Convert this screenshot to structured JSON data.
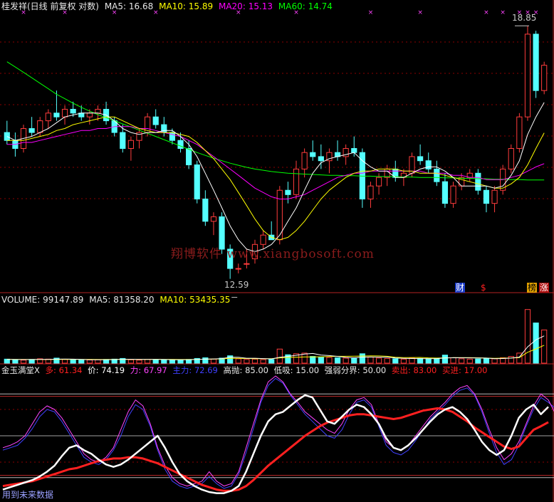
{
  "price_header": {
    "title": "桂发祥(日线 前复权 对数)",
    "ma5_label": "MA5:",
    "ma5_value": "16.68",
    "ma10_label": "MA10:",
    "ma10_value": "15.89",
    "ma20_label": "MA20:",
    "ma20_value": "15.13",
    "ma60_label": "MA60:",
    "ma60_value": "14.74"
  },
  "volume_header": {
    "vol_label": "VOLUME:",
    "vol_value": "99147.89",
    "ma5_label": "MA5:",
    "ma5_value": "81358.20",
    "ma10_label": "MA10:",
    "ma10_value": "53435.35"
  },
  "indicator_header": {
    "title": "金玉满堂X",
    "duo_label": "多:",
    "duo_value": "61.34",
    "jia_label": "价:",
    "jia_value": "74.19",
    "li_label": "力:",
    "li_value": "67.97",
    "zhuli_label": "主力:",
    "zhuli_value": "72.69",
    "gaopao_label": "高抛:",
    "gaopao_value": "85.00",
    "dixi_label": "低吸:",
    "dixi_value": "15.00",
    "qiangruo_label": "强弱分界:",
    "qiangruo_value": "50.00",
    "maichu_label": "卖出:",
    "maichu_value": "83.00",
    "maijin_label": "买进:",
    "maijin_value": "17.00"
  },
  "annotations": {
    "high_price": "18.85",
    "low_price": "12.59",
    "cai_tag": "财",
    "dollar_tag": "$",
    "bang_tag": "榜",
    "zhang_tag": "涨",
    "future_data_note": "用到未来数据",
    "watermark": "翔博软件 www.xiangbosoft.com"
  },
  "colors": {
    "up": "#ff3c3c",
    "down": "#54ffff",
    "ma5": "#ffffff",
    "ma10": "#ffff00",
    "ma20": "#ff00ff",
    "ma60": "#00ff00",
    "grid": "#8b0000",
    "divider": "#b22222",
    "duo": "#ff2020",
    "jia": "#ffffff",
    "li": "#ff44ff",
    "zhuli": "#4040ff"
  },
  "chart_data": [
    {
      "type": "candlestick",
      "scale": "log",
      "series_names": [
        "MA5",
        "MA10",
        "MA20",
        "MA60"
      ],
      "last_ma": {
        "MA5": 16.68,
        "MA10": 15.89,
        "MA20": 15.13,
        "MA60": 14.74
      },
      "ylim": [
        12.4,
        19.2
      ],
      "high": 18.85,
      "low": 12.59,
      "ohlc": [
        [
          15.9,
          16.2,
          15.6,
          15.7
        ],
        [
          15.7,
          15.9,
          15.3,
          15.5
        ],
        [
          15.5,
          16.1,
          15.4,
          16.0
        ],
        [
          16.0,
          16.3,
          15.8,
          15.9
        ],
        [
          15.9,
          16.3,
          15.8,
          16.2
        ],
        [
          16.2,
          16.5,
          16.0,
          16.4
        ],
        [
          16.4,
          17.0,
          16.2,
          16.3
        ],
        [
          16.3,
          16.6,
          16.1,
          16.5
        ],
        [
          16.5,
          16.7,
          16.3,
          16.4
        ],
        [
          16.4,
          16.6,
          16.2,
          16.3
        ],
        [
          16.3,
          16.5,
          16.1,
          16.4
        ],
        [
          16.4,
          16.6,
          16.2,
          16.5
        ],
        [
          16.5,
          16.7,
          16.1,
          16.2
        ],
        [
          16.2,
          16.3,
          15.8,
          15.9
        ],
        [
          15.9,
          16.1,
          15.4,
          15.5
        ],
        [
          15.5,
          15.8,
          15.2,
          15.7
        ],
        [
          15.7,
          16.0,
          15.5,
          15.9
        ],
        [
          15.9,
          16.4,
          15.8,
          16.3
        ],
        [
          16.3,
          16.5,
          16.0,
          16.1
        ],
        [
          16.1,
          16.3,
          15.8,
          15.9
        ],
        [
          15.9,
          16.0,
          15.6,
          15.7
        ],
        [
          15.7,
          15.9,
          15.4,
          15.5
        ],
        [
          15.5,
          15.7,
          15.0,
          15.1
        ],
        [
          15.1,
          15.2,
          14.2,
          14.3
        ],
        [
          14.3,
          14.5,
          13.7,
          13.8
        ],
        [
          13.8,
          14.0,
          13.5,
          13.9
        ],
        [
          13.9,
          14.0,
          13.1,
          13.2
        ],
        [
          13.2,
          13.3,
          12.59,
          12.8
        ],
        [
          12.8,
          12.9,
          12.7,
          12.8
        ],
        [
          12.9,
          13.2,
          12.8,
          12.9
        ],
        [
          13.0,
          13.4,
          12.9,
          13.3
        ],
        [
          13.3,
          13.6,
          13.2,
          13.5
        ],
        [
          13.5,
          13.8,
          13.4,
          13.4
        ],
        [
          13.4,
          14.6,
          13.3,
          14.5
        ],
        [
          14.5,
          14.7,
          14.2,
          14.4
        ],
        [
          14.4,
          15.2,
          14.3,
          15.0
        ],
        [
          15.0,
          15.5,
          14.8,
          15.4
        ],
        [
          15.4,
          15.7,
          15.2,
          15.3
        ],
        [
          15.3,
          15.6,
          15.0,
          15.2
        ],
        [
          15.2,
          15.5,
          14.9,
          15.4
        ],
        [
          15.4,
          15.7,
          15.2,
          15.3
        ],
        [
          15.3,
          15.6,
          15.1,
          15.5
        ],
        [
          15.5,
          15.8,
          15.3,
          15.4
        ],
        [
          15.4,
          15.5,
          14.1,
          14.3
        ],
        [
          14.3,
          14.7,
          14.1,
          14.6
        ],
        [
          14.6,
          14.9,
          14.4,
          14.8
        ],
        [
          14.8,
          15.1,
          14.6,
          15.0
        ],
        [
          15.0,
          15.2,
          14.7,
          14.8
        ],
        [
          14.8,
          15.0,
          14.6,
          14.9
        ],
        [
          14.9,
          15.4,
          14.8,
          15.3
        ],
        [
          15.3,
          15.6,
          15.1,
          15.2
        ],
        [
          15.2,
          15.4,
          14.9,
          15.0
        ],
        [
          15.0,
          15.2,
          14.6,
          14.7
        ],
        [
          14.7,
          14.9,
          14.1,
          14.2
        ],
        [
          14.2,
          14.7,
          14.1,
          14.6
        ],
        [
          14.6,
          14.9,
          14.5,
          14.8
        ],
        [
          14.8,
          15.0,
          14.7,
          14.9
        ],
        [
          14.9,
          15.0,
          14.4,
          14.5
        ],
        [
          14.5,
          14.6,
          14.0,
          14.2
        ],
        [
          14.2,
          14.6,
          14.0,
          14.5
        ],
        [
          14.5,
          15.1,
          14.4,
          15.0
        ],
        [
          15.0,
          15.6,
          14.9,
          15.5
        ],
        [
          15.5,
          16.4,
          15.4,
          16.3
        ],
        [
          16.3,
          18.85,
          16.2,
          18.6
        ],
        [
          18.6,
          18.7,
          16.8,
          17.0
        ],
        [
          17.0,
          17.8,
          16.9,
          17.7
        ]
      ],
      "ma5": [
        15.8,
        15.7,
        15.75,
        15.8,
        15.9,
        16.0,
        16.15,
        16.3,
        16.35,
        16.4,
        16.4,
        16.4,
        16.35,
        16.2,
        16.0,
        15.9,
        15.85,
        15.9,
        15.9,
        15.95,
        15.95,
        15.8,
        15.6,
        15.3,
        14.9,
        14.5,
        14.1,
        13.7,
        13.4,
        13.2,
        13.15,
        13.2,
        13.3,
        13.5,
        13.8,
        14.1,
        14.5,
        14.9,
        15.15,
        15.25,
        15.3,
        15.35,
        15.4,
        15.2,
        15.05,
        14.95,
        14.95,
        14.8,
        14.8,
        14.9,
        15.0,
        15.05,
        15.05,
        14.95,
        14.8,
        14.6,
        14.6,
        14.6,
        14.6,
        14.55,
        14.6,
        14.85,
        15.2,
        15.85,
        16.3,
        16.68
      ],
      "ma10": [
        15.7,
        15.7,
        15.7,
        15.75,
        15.8,
        15.85,
        15.95,
        16.0,
        16.1,
        16.15,
        16.2,
        16.25,
        16.3,
        16.3,
        16.2,
        16.1,
        16.0,
        15.95,
        15.9,
        15.9,
        15.9,
        15.85,
        15.8,
        15.65,
        15.45,
        15.25,
        15.0,
        14.75,
        14.45,
        14.15,
        13.85,
        13.6,
        13.45,
        13.4,
        13.45,
        13.6,
        13.8,
        14.05,
        14.3,
        14.5,
        14.65,
        14.8,
        14.9,
        14.95,
        14.95,
        15.0,
        15.0,
        15.0,
        14.95,
        14.95,
        14.9,
        14.9,
        14.9,
        14.85,
        14.8,
        14.75,
        14.7,
        14.65,
        14.6,
        14.55,
        14.55,
        14.65,
        14.8,
        15.1,
        15.5,
        15.89
      ],
      "ma20": [
        15.6,
        15.6,
        15.65,
        15.65,
        15.7,
        15.75,
        15.8,
        15.85,
        15.9,
        15.95,
        15.95,
        16.0,
        16.0,
        16.05,
        16.05,
        16.05,
        16.0,
        16.0,
        15.95,
        15.9,
        15.85,
        15.8,
        15.7,
        15.6,
        15.45,
        15.3,
        15.15,
        15.0,
        14.85,
        14.7,
        14.55,
        14.45,
        14.35,
        14.3,
        14.3,
        14.35,
        14.4,
        14.5,
        14.6,
        14.7,
        14.8,
        14.85,
        14.9,
        14.9,
        14.95,
        14.95,
        14.95,
        14.95,
        14.95,
        14.95,
        14.95,
        14.9,
        14.9,
        14.9,
        14.85,
        14.85,
        14.8,
        14.8,
        14.75,
        14.75,
        14.75,
        14.8,
        14.85,
        14.95,
        15.05,
        15.13
      ],
      "ma60": [
        17.8,
        17.65,
        17.5,
        17.35,
        17.2,
        17.05,
        16.9,
        16.78,
        16.66,
        16.55,
        16.45,
        16.36,
        16.28,
        16.2,
        16.12,
        16.04,
        15.96,
        15.88,
        15.8,
        15.72,
        15.64,
        15.56,
        15.48,
        15.4,
        15.33,
        15.26,
        15.2,
        15.14,
        15.09,
        15.04,
        15.0,
        14.97,
        14.94,
        14.92,
        14.9,
        14.89,
        14.88,
        14.87,
        14.86,
        14.85,
        14.85,
        14.84,
        14.84,
        14.83,
        14.83,
        14.82,
        14.82,
        14.82,
        14.81,
        14.81,
        14.8,
        14.8,
        14.8,
        14.79,
        14.79,
        14.78,
        14.78,
        14.77,
        14.77,
        14.76,
        14.76,
        14.75,
        14.75,
        14.74,
        14.74,
        14.74
      ]
    },
    {
      "type": "bar",
      "series_names": [
        "VOLUME",
        "MA5",
        "MA10"
      ],
      "last": {
        "VOLUME": 99147.89,
        "MA5": 81358.2,
        "MA10": 53435.35
      },
      "ylim": [
        0,
        170000
      ],
      "volume": [
        12000,
        10000,
        9000,
        11000,
        13000,
        12000,
        15000,
        11000,
        10000,
        9000,
        9500,
        10000,
        11000,
        12000,
        14000,
        10000,
        9000,
        11000,
        10500,
        9800,
        9000,
        10000,
        11000,
        14000,
        16000,
        12000,
        15000,
        22000,
        13000,
        11000,
        12000,
        10500,
        11000,
        42000,
        25000,
        28000,
        30000,
        20000,
        18000,
        17000,
        16000,
        15000,
        14000,
        28000,
        18000,
        15000,
        14000,
        13000,
        12000,
        15000,
        14000,
        13000,
        14000,
        24000,
        16000,
        13000,
        12000,
        12500,
        14000,
        13000,
        16000,
        20000,
        30000,
        160000,
        120000,
        99147.89
      ],
      "ma5": [
        11000,
        10800,
        10600,
        10800,
        11000,
        11000,
        12000,
        12200,
        11800,
        11000,
        10100,
        9900,
        10100,
        10700,
        11500,
        11400,
        11200,
        11200,
        11100,
        10900,
        10000,
        10100,
        10300,
        11000,
        12000,
        12600,
        13600,
        17800,
        17600,
        14600,
        14600,
        13700,
        12500,
        17500,
        20100,
        23300,
        27200,
        29000,
        24200,
        22600,
        20200,
        17200,
        16000,
        18000,
        18200,
        18000,
        17800,
        15600,
        14400,
        13800,
        13600,
        13400,
        13600,
        15600,
        16200,
        16000,
        15800,
        15500,
        15000,
        13300,
        13900,
        15100,
        18000,
        48600,
        69800,
        81358.2
      ],
      "ma10": [
        11500,
        11300,
        11000,
        10900,
        10900,
        10900,
        11200,
        11300,
        11300,
        11200,
        11000,
        10900,
        10900,
        11000,
        11300,
        11300,
        11200,
        11300,
        11400,
        11300,
        11000,
        10900,
        10900,
        11300,
        11800,
        12200,
        12800,
        14300,
        14300,
        13900,
        13400,
        13200,
        13300,
        15700,
        17000,
        17700,
        18400,
        18800,
        18900,
        19600,
        20500,
        20400,
        20600,
        21200,
        21800,
        21400,
        20500,
        17700,
        16600,
        16800,
        16900,
        15700,
        15100,
        15700,
        16300,
        16500,
        16500,
        15900,
        15000,
        14500,
        14900,
        15300,
        16600,
        32500,
        42200,
        53435.35
      ]
    },
    {
      "type": "line",
      "title": "金玉满堂X",
      "series_names": [
        "多",
        "价",
        "力",
        "主力"
      ],
      "last": {
        "多": 61.34,
        "价": 74.19,
        "力": 67.97,
        "主力": 72.69
      },
      "reference_lines": {
        "高抛": 85.0,
        "卖出": 83.0,
        "强弱分界": 50.0,
        "买进": 17.0,
        "低吸": 15.0
      },
      "ylim": [
        0,
        100
      ],
      "duo": [
        8,
        9,
        10,
        11,
        12,
        14,
        16,
        18,
        20,
        22,
        23,
        25,
        27,
        29,
        30,
        31,
        31,
        32,
        32,
        31,
        29,
        27,
        24,
        21,
        18,
        15,
        12,
        9,
        7,
        5,
        4,
        4,
        5,
        8,
        13,
        19,
        25,
        30,
        35,
        40,
        45,
        50,
        54,
        58,
        61,
        63,
        65,
        67,
        68,
        68,
        67,
        66,
        65,
        64,
        65,
        67,
        69,
        71,
        72,
        73,
        72,
        70,
        66,
        62,
        57,
        53,
        49,
        45,
        41,
        39,
        41,
        48,
        55,
        58,
        61.34
      ],
      "jia": [
        5,
        7,
        9,
        11,
        13,
        16,
        20,
        25,
        33,
        40,
        42,
        38,
        35,
        30,
        26,
        24,
        26,
        30,
        35,
        40,
        45,
        50,
        40,
        28,
        18,
        12,
        8,
        5,
        3,
        2,
        2,
        4,
        8,
        20,
        35,
        50,
        62,
        68,
        70,
        75,
        80,
        84,
        82,
        72,
        62,
        60,
        66,
        72,
        76,
        74,
        68,
        60,
        48,
        40,
        38,
        42,
        48,
        55,
        62,
        68,
        72,
        74,
        70,
        64,
        55,
        45,
        38,
        34,
        38,
        50,
        65,
        72,
        76,
        68,
        74.19
      ],
      "li": [
        40,
        42,
        45,
        50,
        60,
        70,
        75,
        72,
        65,
        55,
        45,
        35,
        30,
        28,
        32,
        40,
        55,
        70,
        80,
        75,
        60,
        40,
        25,
        15,
        10,
        8,
        10,
        12,
        20,
        12,
        8,
        10,
        20,
        40,
        60,
        80,
        95,
        100,
        95,
        85,
        78,
        70,
        65,
        60,
        55,
        52,
        60,
        72,
        80,
        82,
        76,
        60,
        45,
        40,
        38,
        42,
        50,
        58,
        66,
        72,
        78,
        85,
        90,
        92,
        85,
        72,
        55,
        40,
        30,
        35,
        45,
        60,
        75,
        85,
        80,
        67.97
      ],
      "zhuli": [
        38,
        40,
        42,
        48,
        56,
        66,
        72,
        70,
        62,
        52,
        42,
        32,
        28,
        26,
        30,
        38,
        50,
        66,
        76,
        72,
        58,
        38,
        22,
        12,
        8,
        6,
        8,
        10,
        16,
        10,
        6,
        8,
        18,
        36,
        56,
        78,
        92,
        98,
        94,
        84,
        76,
        68,
        62,
        56,
        50,
        48,
        55,
        68,
        78,
        80,
        74,
        58,
        42,
        36,
        34,
        38,
        46,
        55,
        64,
        70,
        76,
        83,
        88,
        90,
        84,
        70,
        52,
        36,
        26,
        30,
        42,
        58,
        72,
        82,
        78,
        72.69
      ]
    }
  ]
}
